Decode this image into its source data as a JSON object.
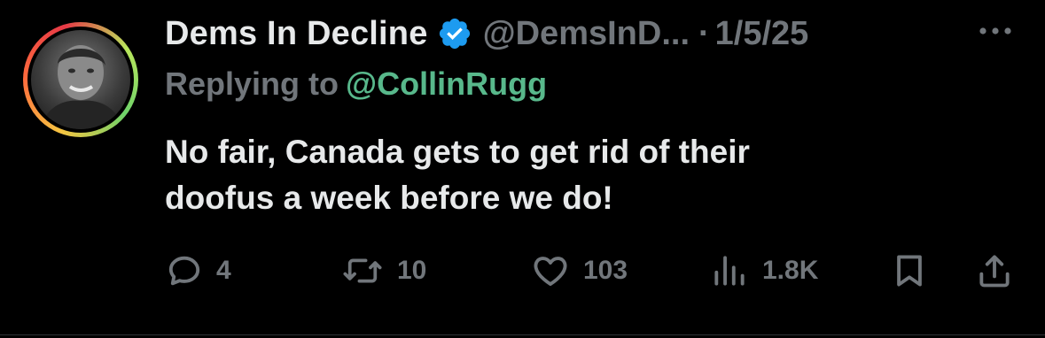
{
  "author": {
    "display_name": "Dems In Decline",
    "handle": "@DemsInD...",
    "separator": "·",
    "date": "1/5/25",
    "verified": true
  },
  "reply": {
    "prefix": "Replying to",
    "handle": "@CollinRugg"
  },
  "tweet": {
    "lines": [
      "No fair, Canada gets to get rid of their",
      "doofus a week before we do!"
    ]
  },
  "actions": {
    "replies": "4",
    "reposts": "10",
    "likes": "103",
    "views": "1.8K"
  },
  "icons": {
    "verified": "verified-badge-icon",
    "more": "more-options-icon",
    "reply": "reply-icon",
    "repost": "repost-icon",
    "like": "heart-icon",
    "views": "views-chart-icon",
    "bookmark": "bookmark-icon",
    "share": "share-icon"
  },
  "colors": {
    "background": "#000000",
    "primary_text": "#e7e9ea",
    "secondary_text": "#71767b",
    "mention": "#58b88b",
    "verified_blue": "#1d9bf0"
  }
}
